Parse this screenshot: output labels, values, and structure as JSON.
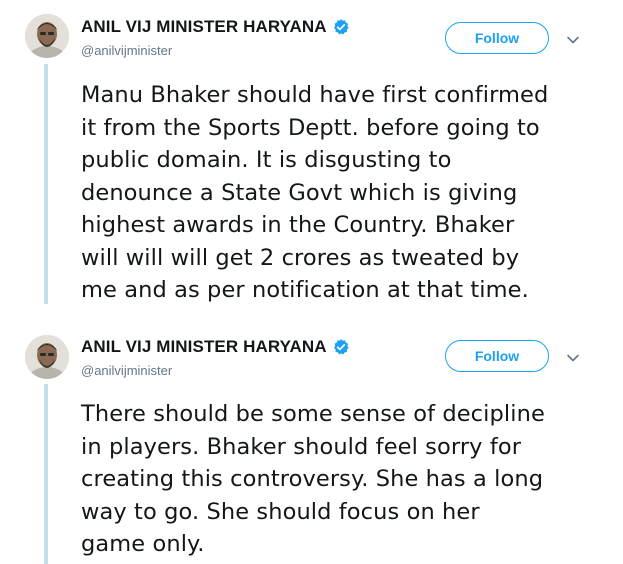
{
  "colors": {
    "accent": "#1da1f2",
    "text": "#14171a",
    "muted": "#657786",
    "thread_line": "#c4dcec"
  },
  "tweets": [
    {
      "display_name": "ANIL VIJ MINISTER HARYANA",
      "handle": "@anilvijminister",
      "verified_icon": "verified-badge-icon",
      "follow_label": "Follow",
      "menu_icon": "chevron-down-icon",
      "text": "Manu Bhaker should have first confirmed\nit from the Sports Deptt. before going to\npublic domain. It is disgusting to\ndenounce a State Govt which is giving\nhighest awards in the Country. Bhaker\nwill will will get 2 crores as tweated by\nme and as per notification at that time."
    },
    {
      "display_name": "ANIL VIJ MINISTER HARYANA",
      "handle": "@anilvijminister",
      "verified_icon": "verified-badge-icon",
      "follow_label": "Follow",
      "menu_icon": "chevron-down-icon",
      "text": "There should be some sense of decipline\nin players. Bhaker  should feel sorry for\ncreating this controversy. She has a long\nway to go. She should focus on her\ngame only."
    }
  ]
}
